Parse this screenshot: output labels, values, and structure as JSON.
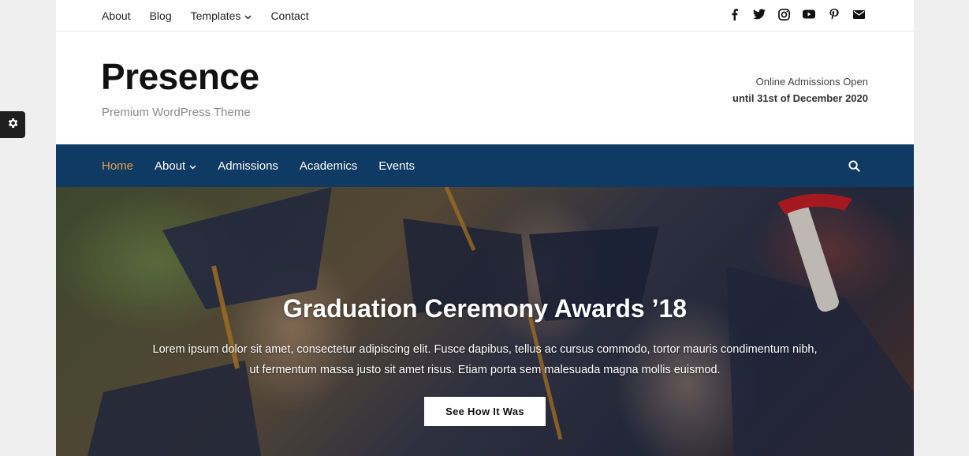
{
  "topbar": {
    "nav": [
      {
        "label": "About"
      },
      {
        "label": "Blog"
      },
      {
        "label": "Templates",
        "has_dropdown": true
      },
      {
        "label": "Contact"
      }
    ],
    "social_icons": [
      "facebook-icon",
      "twitter-icon",
      "instagram-icon",
      "youtube-icon",
      "pinterest-icon",
      "mail-icon"
    ]
  },
  "header": {
    "site_title": "Presence",
    "tagline": "Premium WordPress Theme",
    "admissions_line1": "Online Admissions Open",
    "admissions_line2": "until 31st of December 2020"
  },
  "main_nav": {
    "items": [
      {
        "label": "Home",
        "active": true
      },
      {
        "label": "About",
        "has_dropdown": true
      },
      {
        "label": "Admissions"
      },
      {
        "label": "Academics"
      },
      {
        "label": "Events"
      }
    ],
    "search_icon": "search-icon"
  },
  "hero": {
    "title": "Graduation Ceremony Awards ’18",
    "text": "Lorem ipsum dolor sit amet, consectetur adipiscing elit. Fusce dapibus, tellus ac cursus commodo, tortor mauris condimentum nibh, ut fermentum massa justo sit amet risus. Etiam porta sem malesuada magna mollis euismod.",
    "button_label": "See How It Was"
  },
  "settings_tab": {
    "icon": "gear-icon"
  },
  "colors": {
    "nav_bg": "#0e3a64",
    "nav_active": "#e0a34a",
    "page_bg": "#efefef"
  }
}
